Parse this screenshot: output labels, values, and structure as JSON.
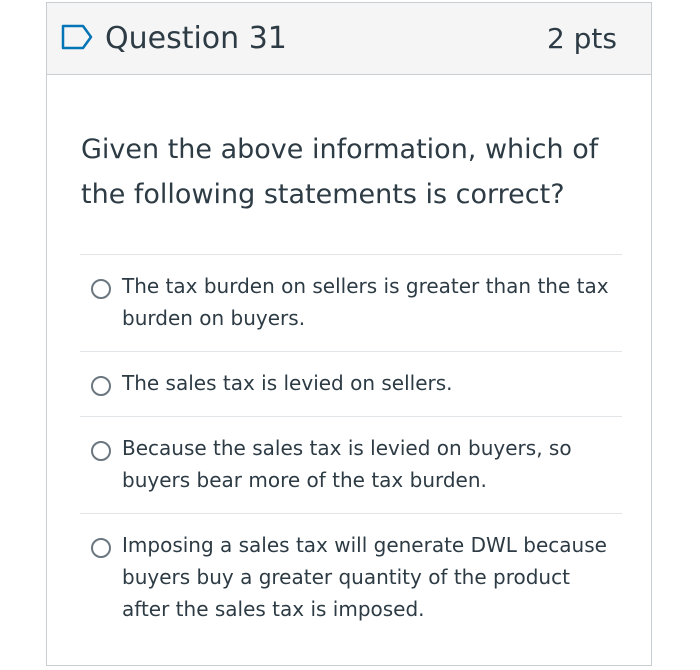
{
  "question": {
    "title": "Question 31",
    "points": "2 pts",
    "flag_icon": "flag-outline-icon",
    "prompt": "Given the above information, which of the following statements is correct?"
  },
  "answers": [
    {
      "label": "The tax burden on sellers is greater than the tax burden on buyers."
    },
    {
      "label": "The sales tax is levied on sellers."
    },
    {
      "label": "Because the sales tax is levied on buyers, so buyers bear more of the tax burden."
    },
    {
      "label": "Imposing a sales tax will generate DWL because buyers buy a greater quantity of the product after the sales tax is imposed."
    }
  ],
  "colors": {
    "accent": "#0374b5",
    "text": "#2d3b45",
    "border": "#c7cdd1",
    "header_bg": "#f5f5f5"
  }
}
